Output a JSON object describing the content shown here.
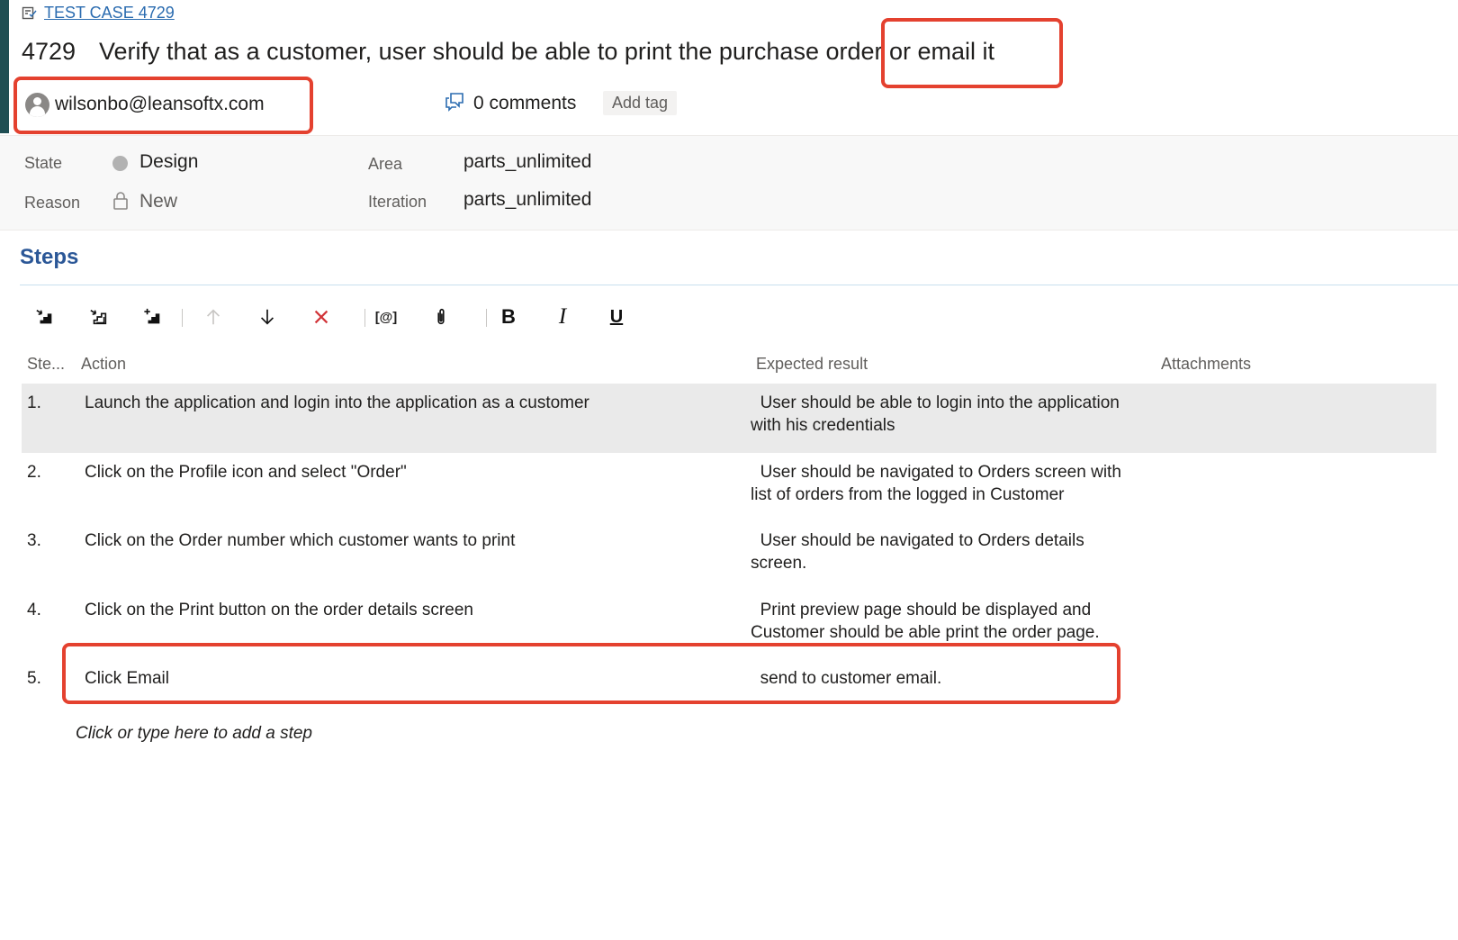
{
  "header": {
    "type_link": "TEST CASE 4729",
    "id": "4729",
    "title": "Verify that as a customer, user should be able to print the purchase order or email it",
    "assignee": "wilsonbo@leansoftx.com",
    "comments": "0 comments",
    "add_tag": "Add tag"
  },
  "fields": {
    "state_label": "State",
    "state_value": "Design",
    "reason_label": "Reason",
    "reason_value": "New",
    "area_label": "Area",
    "area_value": "parts_unlimited",
    "iteration_label": "Iteration",
    "iteration_value": "parts_unlimited"
  },
  "steps": {
    "title": "Steps",
    "toolbar": {
      "mention_label": "[@]",
      "bold_label": "B",
      "italic_label": "I",
      "underline_label": "U"
    },
    "columns": [
      "Ste...",
      "Action",
      "Expected result",
      "Attachments"
    ],
    "rows": [
      {
        "num": "1.",
        "action": "Launch the application and login into the application as a customer",
        "expected": "  User should be able to login into the application\nwith his credentials"
      },
      {
        "num": "2.",
        "action": "Click on the Profile icon and select \"Order\"",
        "expected": "  User should be navigated to Orders screen with\nlist of orders from the logged in Customer"
      },
      {
        "num": "3.",
        "action": "Click on the Order number which customer wants to print",
        "expected": "  User should be navigated to Orders details\nscreen."
      },
      {
        "num": "4.",
        "action": "Click on the Print button on the order details screen",
        "expected": "  Print preview page should be displayed and\nCustomer should be able print the order page."
      },
      {
        "num": "5.",
        "action": "Click Email",
        "expected": "  send to customer email."
      }
    ],
    "add_step": "Click or type here to add a step"
  },
  "colors": {
    "accent_bar": "#1f4e53",
    "link": "#2b6cb0",
    "steps_title": "#2b5797",
    "annotation": "#e4412f",
    "delete_icon": "#d13438"
  }
}
